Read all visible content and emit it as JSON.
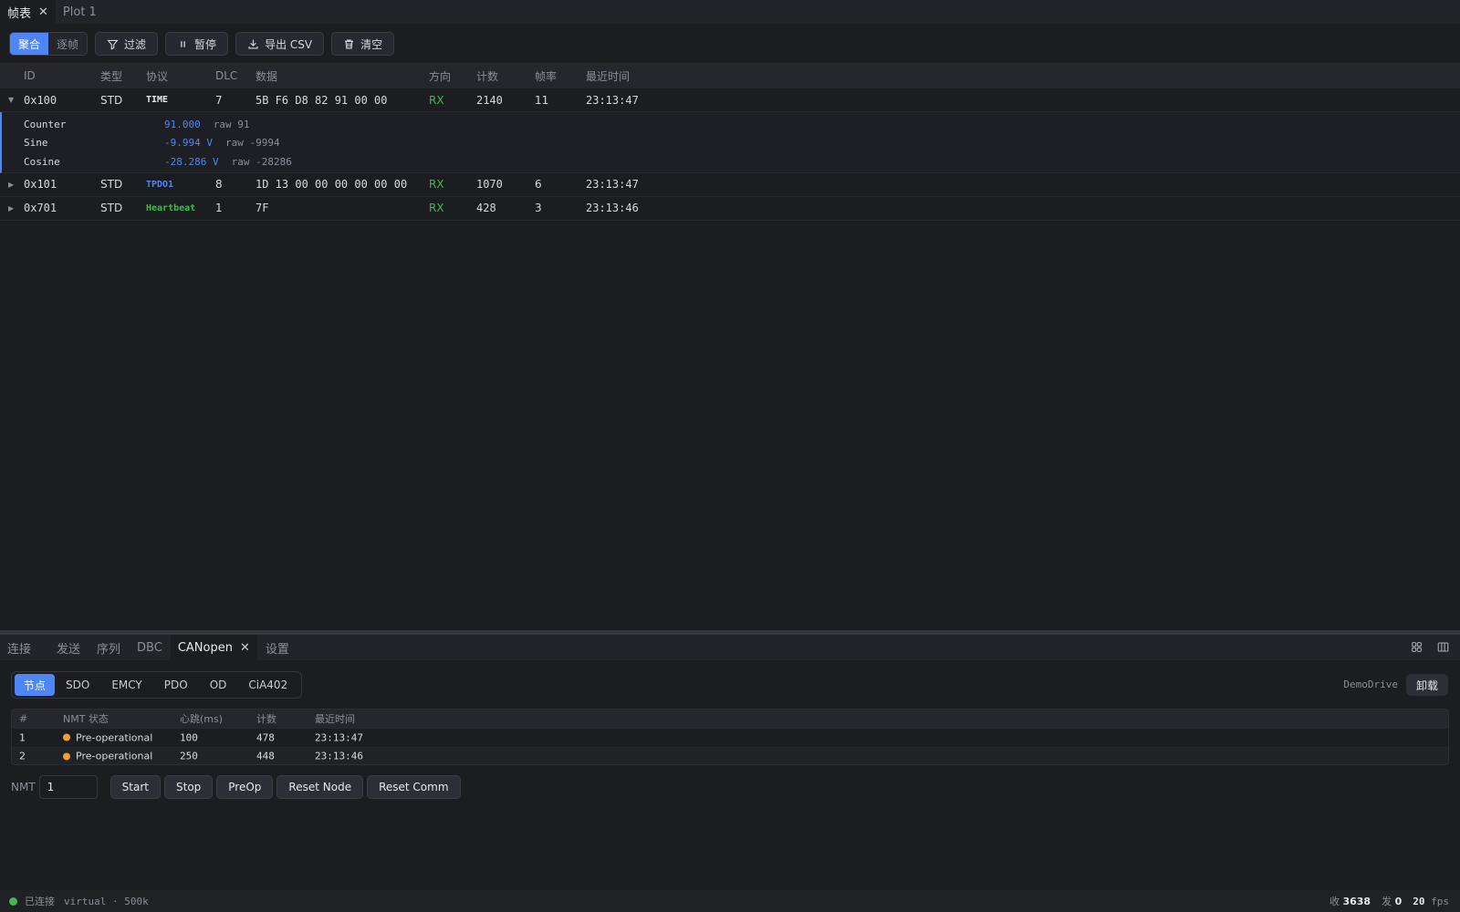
{
  "colors": {
    "accent": "#4f86f7",
    "rx": "#3fb950",
    "warning_dot": "#f0a030",
    "connected": "#3fb950"
  },
  "top_tabs": [
    {
      "label": "帧表",
      "active": true,
      "closable": true
    },
    {
      "label": "Plot 1",
      "active": false,
      "closable": false
    }
  ],
  "toolbar": {
    "mode_aggregate": "聚合",
    "mode_per_frame": "逐帧",
    "filter": "过滤",
    "pause": "暂停",
    "export_csv": "导出 CSV",
    "clear": "清空"
  },
  "frame_table": {
    "headers": {
      "id": "ID",
      "type": "类型",
      "protocol": "协议",
      "dlc": "DLC",
      "data": "数据",
      "direction": "方向",
      "count": "计数",
      "rate": "帧率",
      "last_time": "最近时间"
    },
    "rows": [
      {
        "expanded": true,
        "id": "0x100",
        "type": "STD",
        "protocol": "TIME",
        "dlc": "7",
        "data": "5B F6 D8 82 91 00 00",
        "direction": "RX",
        "count": "2140",
        "rate": "11",
        "last_time": "23:13:47"
      },
      {
        "expanded": false,
        "id": "0x101",
        "type": "STD",
        "protocol": "TPDO1",
        "dlc": "8",
        "data": "1D 13 00 00 00 00 00 00",
        "direction": "RX",
        "count": "1070",
        "rate": "6",
        "last_time": "23:13:47"
      },
      {
        "expanded": false,
        "id": "0x701",
        "type": "STD",
        "protocol": "Heartbeat",
        "dlc": "1",
        "data": "7F",
        "direction": "RX",
        "count": "428",
        "rate": "3",
        "last_time": "23:13:46"
      }
    ],
    "signals": [
      {
        "name": "Counter",
        "value": "91.000",
        "raw": "raw 91"
      },
      {
        "name": "Sine",
        "value": "-9.994 V",
        "raw": "raw -9994"
      },
      {
        "name": "Cosine",
        "value": "-28.286 V",
        "raw": "raw -28286"
      }
    ]
  },
  "panel_tabs": [
    {
      "label": "连接"
    },
    {
      "label": "发送"
    },
    {
      "label": "序列"
    },
    {
      "label": "DBC"
    },
    {
      "label": "CANopen",
      "active": true
    },
    {
      "label": "设置"
    }
  ],
  "canopen": {
    "subtabs": [
      "节点",
      "SDO",
      "EMCY",
      "PDO",
      "OD",
      "CiA402"
    ],
    "active_subtab": "节点",
    "drive_name": "DemoDrive",
    "unload": "卸载",
    "node_headers": {
      "index": "#",
      "nmt_state": "NMT 状态",
      "heartbeat": "心跳(ms)",
      "count": "计数",
      "last_time": "最近时间"
    },
    "nodes": [
      {
        "index": "1",
        "nmt_state": "Pre-operational",
        "heartbeat": "100",
        "count": "478",
        "last_time": "23:13:47"
      },
      {
        "index": "2",
        "nmt_state": "Pre-operational",
        "heartbeat": "250",
        "count": "448",
        "last_time": "23:13:46"
      }
    ],
    "nmt_label": "NMT",
    "nmt_node_value": "1",
    "nmt_buttons": [
      "Start",
      "Stop",
      "PreOp",
      "Reset Node",
      "Reset Comm"
    ]
  },
  "status": {
    "connection": "已连接",
    "interface": "virtual · 500k",
    "rx_label": "收",
    "rx_count": "3638",
    "tx_label": "发",
    "tx_count": "0",
    "fps_value": "20",
    "fps_unit": "fps"
  }
}
